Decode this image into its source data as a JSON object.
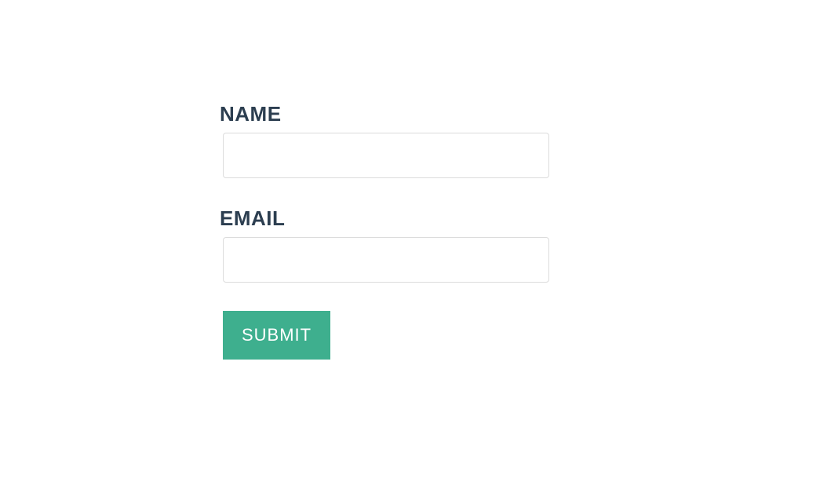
{
  "form": {
    "name": {
      "label": "NAME",
      "value": ""
    },
    "email": {
      "label": "EMAIL",
      "value": ""
    },
    "submit_label": "SUBMIT"
  }
}
